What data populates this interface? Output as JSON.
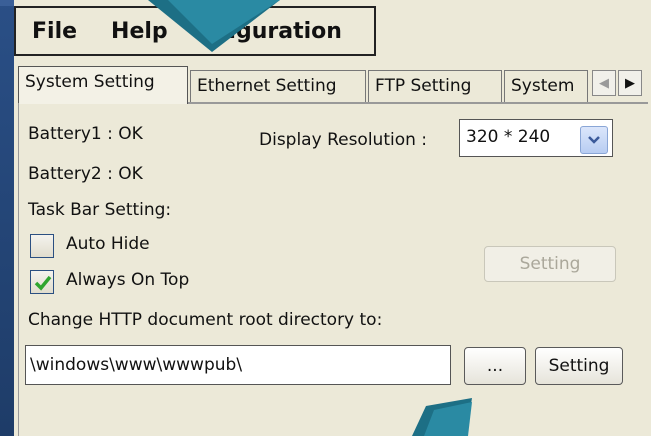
{
  "menu": {
    "file": "File",
    "help": "Help",
    "configuration": "figuration"
  },
  "tabs": [
    {
      "label": "System Setting",
      "active": true
    },
    {
      "label": "Ethernet Setting",
      "active": false
    },
    {
      "label": "FTP Setting",
      "active": false
    },
    {
      "label": "System",
      "active": false
    }
  ],
  "status": {
    "battery1": "Battery1 : OK",
    "battery2": "Battery2 : OK"
  },
  "display": {
    "label": "Display Resolution :",
    "value": "320 * 240"
  },
  "taskbar": {
    "heading": "Task Bar Setting:",
    "auto_hide": {
      "label": "Auto Hide",
      "checked": false
    },
    "always_on_top": {
      "label": "Always On Top",
      "checked": true
    },
    "setting_button": "Setting"
  },
  "http": {
    "heading": "Change HTTP document root directory to:",
    "path": "\\windows\\www\\wwwpub\\",
    "browse_button": "...",
    "setting_button": "Setting"
  },
  "icons": {
    "tab_scroll_left": "chevron-left-icon",
    "tab_scroll_right": "chevron-right-icon",
    "dropdown": "chevron-down-icon",
    "check": "checkmark-icon"
  },
  "colors": {
    "window_bg": "#ece9d8",
    "overlay_arrow": "#1d6f85",
    "check_green": "#2fa52f"
  }
}
